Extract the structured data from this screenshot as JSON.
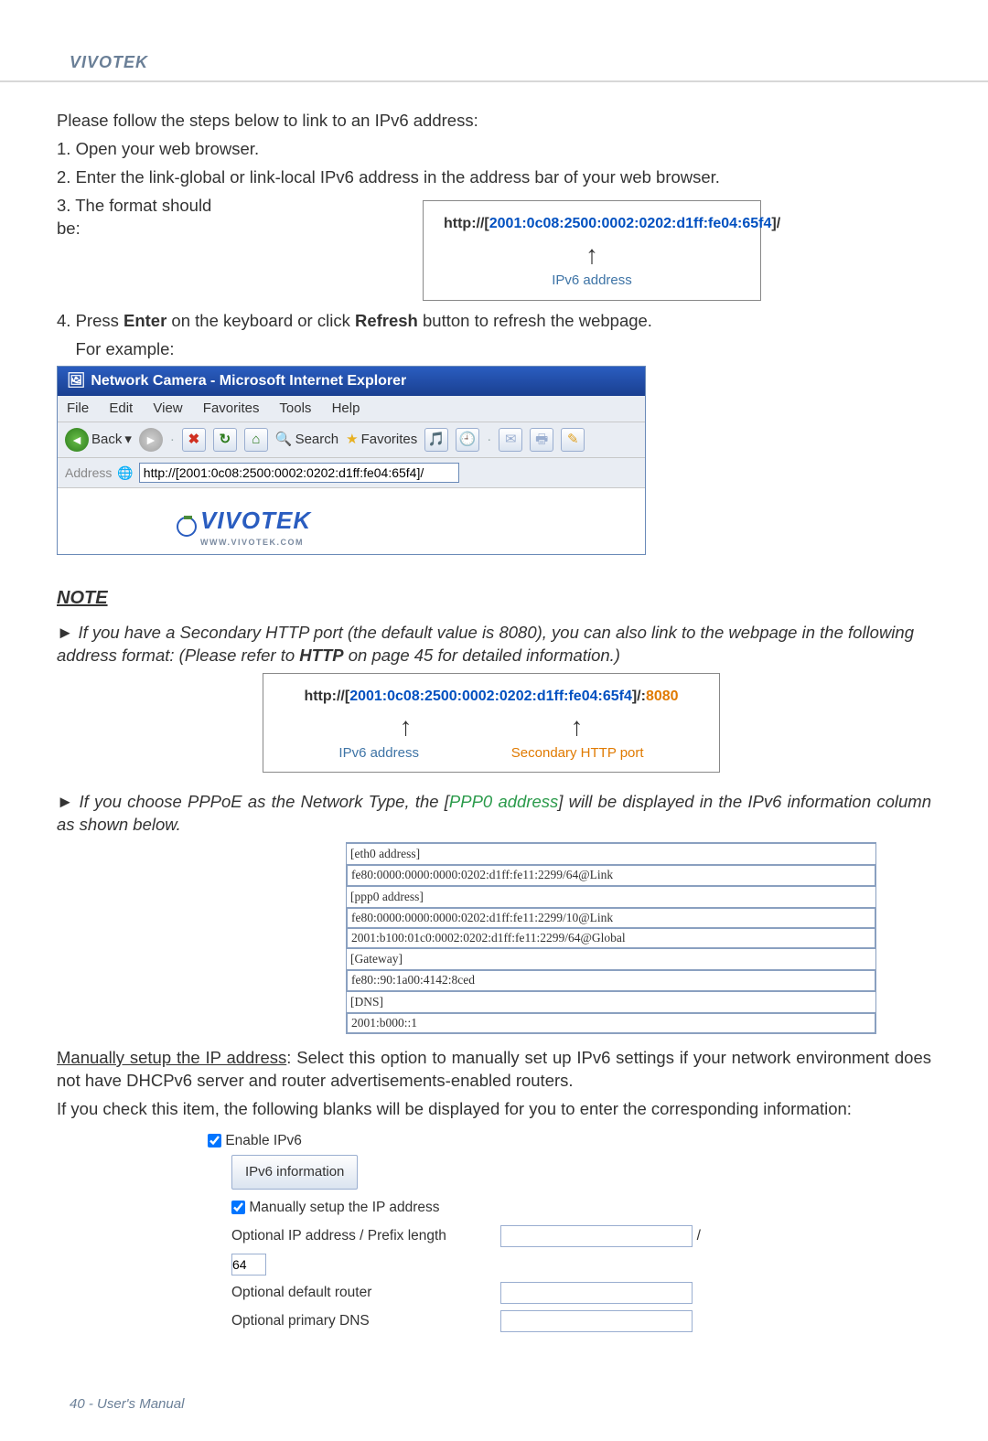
{
  "brand": "VIVOTEK",
  "intro": {
    "lead": "Please follow the steps below to link to an IPv6 address:",
    "step1": "1. Open your web browser.",
    "step2": "2. Enter the link-global or link-local IPv6 address in the address bar of your web browser.",
    "step3": "3. The format should be:",
    "step4a": "4. Press ",
    "enter": "Enter",
    "step4b": " on the keyboard or click ",
    "refresh": "Refresh",
    "step4c": " button to refresh the webpage.",
    "example": "    For example:"
  },
  "box1": {
    "prefix": "http://[",
    "ipv6": "2001:0c08:2500:0002:0202:d1ff:fe04:65f4",
    "suffix": "]/",
    "label": "IPv6 address"
  },
  "ie": {
    "title": "Network Camera - Microsoft Internet Explorer",
    "menu": {
      "file": "File",
      "edit": "Edit",
      "view": "View",
      "fav": "Favorites",
      "tools": "Tools",
      "help": "Help"
    },
    "toolbar": {
      "back": "Back",
      "search": "Search",
      "favorites": "Favorites"
    },
    "addr_label": "Address",
    "addr_value": "http://[2001:0c08:2500:0002:0202:d1ff:fe04:65f4]/",
    "logo": "VIVOTEK",
    "logo_sub": "WWW.VIVOTEK.COM"
  },
  "note": {
    "heading": "NOTE",
    "n1a": "► If you have a Secondary HTTP port (the default value is 8080), you can also link to the webpage in the following address format: (Please refer to ",
    "n1b": "HTTP",
    "n1c": " on page 45 for detailed information.)"
  },
  "box2": {
    "prefix": "http://[",
    "ipv6": "2001:0c08:2500:0002:0202:d1ff:fe04:65f4",
    "suffix": "]/:",
    "port": "8080",
    "label1": "IPv6 address",
    "label2": "Secondary HTTP port"
  },
  "note2": {
    "a": "► If you choose PPPoE as the Network Type, the [",
    "ppp": "PPP0 address",
    "b": "] will be displayed in the IPv6 information column as shown below."
  },
  "info_table": {
    "r0": "[eth0 address]",
    "r1": "fe80:0000:0000:0000:0202:d1ff:fe11:2299/64@Link",
    "r2": "[ppp0 address]",
    "r3": "fe80:0000:0000:0000:0202:d1ff:fe11:2299/10@Link",
    "r4": "2001:b100:01c0:0002:0202:d1ff:fe11:2299/64@Global",
    "r5": "[Gateway]",
    "r6": "fe80::90:1a00:4142:8ced",
    "r7": "[DNS]",
    "r8": "2001:b000::1"
  },
  "manual": {
    "head": "Manually setup the IP address",
    "body": ": Select this option to manually set up IPv6 settings if your network environment does not have DHCPv6 server and router advertisements-enabled routers.",
    "line2": "If you check this item, the following blanks will be displayed for you to enter the corresponding information:"
  },
  "settings": {
    "enable": "Enable IPv6",
    "info_btn": "IPv6 information",
    "manual_cb": "Manually setup the IP address",
    "opt_ip": "Optional IP address / Prefix length",
    "slash": "/",
    "prefix_val": "64",
    "opt_router": "Optional default router",
    "opt_dns": "Optional primary DNS"
  },
  "footer": "40 - User's Manual"
}
